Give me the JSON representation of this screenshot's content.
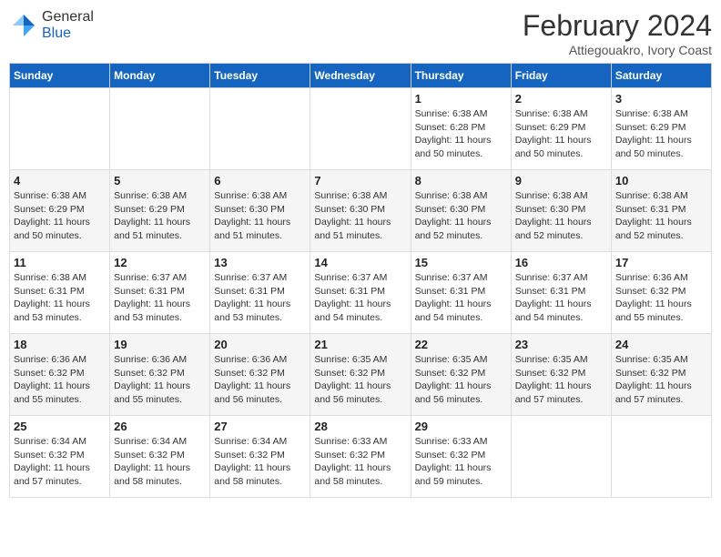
{
  "header": {
    "logo_general": "General",
    "logo_blue": "Blue",
    "month_year": "February 2024",
    "location": "Attiegouakro, Ivory Coast"
  },
  "days_of_week": [
    "Sunday",
    "Monday",
    "Tuesday",
    "Wednesday",
    "Thursday",
    "Friday",
    "Saturday"
  ],
  "weeks": [
    [
      {
        "day": "",
        "info": ""
      },
      {
        "day": "",
        "info": ""
      },
      {
        "day": "",
        "info": ""
      },
      {
        "day": "",
        "info": ""
      },
      {
        "day": "1",
        "info": "Sunrise: 6:38 AM\nSunset: 6:28 PM\nDaylight: 11 hours\nand 50 minutes."
      },
      {
        "day": "2",
        "info": "Sunrise: 6:38 AM\nSunset: 6:29 PM\nDaylight: 11 hours\nand 50 minutes."
      },
      {
        "day": "3",
        "info": "Sunrise: 6:38 AM\nSunset: 6:29 PM\nDaylight: 11 hours\nand 50 minutes."
      }
    ],
    [
      {
        "day": "4",
        "info": "Sunrise: 6:38 AM\nSunset: 6:29 PM\nDaylight: 11 hours\nand 50 minutes."
      },
      {
        "day": "5",
        "info": "Sunrise: 6:38 AM\nSunset: 6:29 PM\nDaylight: 11 hours\nand 51 minutes."
      },
      {
        "day": "6",
        "info": "Sunrise: 6:38 AM\nSunset: 6:30 PM\nDaylight: 11 hours\nand 51 minutes."
      },
      {
        "day": "7",
        "info": "Sunrise: 6:38 AM\nSunset: 6:30 PM\nDaylight: 11 hours\nand 51 minutes."
      },
      {
        "day": "8",
        "info": "Sunrise: 6:38 AM\nSunset: 6:30 PM\nDaylight: 11 hours\nand 52 minutes."
      },
      {
        "day": "9",
        "info": "Sunrise: 6:38 AM\nSunset: 6:30 PM\nDaylight: 11 hours\nand 52 minutes."
      },
      {
        "day": "10",
        "info": "Sunrise: 6:38 AM\nSunset: 6:31 PM\nDaylight: 11 hours\nand 52 minutes."
      }
    ],
    [
      {
        "day": "11",
        "info": "Sunrise: 6:38 AM\nSunset: 6:31 PM\nDaylight: 11 hours\nand 53 minutes."
      },
      {
        "day": "12",
        "info": "Sunrise: 6:37 AM\nSunset: 6:31 PM\nDaylight: 11 hours\nand 53 minutes."
      },
      {
        "day": "13",
        "info": "Sunrise: 6:37 AM\nSunset: 6:31 PM\nDaylight: 11 hours\nand 53 minutes."
      },
      {
        "day": "14",
        "info": "Sunrise: 6:37 AM\nSunset: 6:31 PM\nDaylight: 11 hours\nand 54 minutes."
      },
      {
        "day": "15",
        "info": "Sunrise: 6:37 AM\nSunset: 6:31 PM\nDaylight: 11 hours\nand 54 minutes."
      },
      {
        "day": "16",
        "info": "Sunrise: 6:37 AM\nSunset: 6:31 PM\nDaylight: 11 hours\nand 54 minutes."
      },
      {
        "day": "17",
        "info": "Sunrise: 6:36 AM\nSunset: 6:32 PM\nDaylight: 11 hours\nand 55 minutes."
      }
    ],
    [
      {
        "day": "18",
        "info": "Sunrise: 6:36 AM\nSunset: 6:32 PM\nDaylight: 11 hours\nand 55 minutes."
      },
      {
        "day": "19",
        "info": "Sunrise: 6:36 AM\nSunset: 6:32 PM\nDaylight: 11 hours\nand 55 minutes."
      },
      {
        "day": "20",
        "info": "Sunrise: 6:36 AM\nSunset: 6:32 PM\nDaylight: 11 hours\nand 56 minutes."
      },
      {
        "day": "21",
        "info": "Sunrise: 6:35 AM\nSunset: 6:32 PM\nDaylight: 11 hours\nand 56 minutes."
      },
      {
        "day": "22",
        "info": "Sunrise: 6:35 AM\nSunset: 6:32 PM\nDaylight: 11 hours\nand 56 minutes."
      },
      {
        "day": "23",
        "info": "Sunrise: 6:35 AM\nSunset: 6:32 PM\nDaylight: 11 hours\nand 57 minutes."
      },
      {
        "day": "24",
        "info": "Sunrise: 6:35 AM\nSunset: 6:32 PM\nDaylight: 11 hours\nand 57 minutes."
      }
    ],
    [
      {
        "day": "25",
        "info": "Sunrise: 6:34 AM\nSunset: 6:32 PM\nDaylight: 11 hours\nand 57 minutes."
      },
      {
        "day": "26",
        "info": "Sunrise: 6:34 AM\nSunset: 6:32 PM\nDaylight: 11 hours\nand 58 minutes."
      },
      {
        "day": "27",
        "info": "Sunrise: 6:34 AM\nSunset: 6:32 PM\nDaylight: 11 hours\nand 58 minutes."
      },
      {
        "day": "28",
        "info": "Sunrise: 6:33 AM\nSunset: 6:32 PM\nDaylight: 11 hours\nand 58 minutes."
      },
      {
        "day": "29",
        "info": "Sunrise: 6:33 AM\nSunset: 6:32 PM\nDaylight: 11 hours\nand 59 minutes."
      },
      {
        "day": "",
        "info": ""
      },
      {
        "day": "",
        "info": ""
      }
    ]
  ]
}
